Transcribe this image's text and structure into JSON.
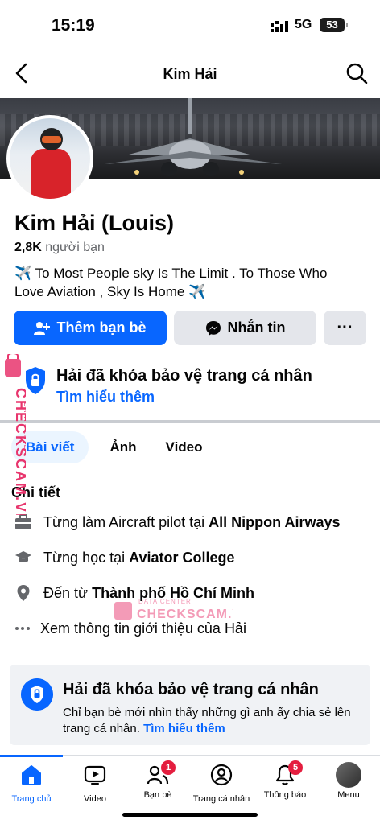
{
  "status_bar": {
    "time": "15:19",
    "network": "5G",
    "battery": "53"
  },
  "header": {
    "title": "Kim Hải"
  },
  "profile": {
    "name": "Kim Hải (Louis)",
    "friends_count": "2,8K",
    "friends_label": "người bạn",
    "bio_line1": "To Most People sky Is The Limit . To Those Who",
    "bio_line2": "Love Aviation , Sky Is Home"
  },
  "actions": {
    "add_friend": "Thêm bạn bè",
    "message": "Nhắn tin",
    "more": "···"
  },
  "lock_banner": {
    "title": "Hải đã khóa bảo vệ trang cá nhân",
    "link": "Tìm hiểu thêm"
  },
  "tabs": [
    "Bài viết",
    "Ảnh",
    "Video"
  ],
  "details": {
    "heading": "Chi tiết",
    "work_prefix": "Từng làm Aircraft pilot tại ",
    "work_place": "All Nippon Airways",
    "school_prefix": "Từng học tại ",
    "school_name": "Aviator College",
    "from_prefix": "Đến từ ",
    "from_place": "Thành phố Hồ Chí Minh",
    "about_link": "Xem thông tin giới thiệu của Hải"
  },
  "lock_card": {
    "title": "Hải đã khóa bảo vệ trang cá nhân",
    "desc": "Chỉ bạn bè mới nhìn thấy những gì anh ấy chia sẻ lên trang cá nhân.",
    "link": "Tìm hiểu thêm"
  },
  "bottom_nav": [
    {
      "label": "Trang chủ",
      "icon": "home-icon"
    },
    {
      "label": "Video",
      "icon": "video-icon"
    },
    {
      "label": "Bạn bè",
      "icon": "friends-icon",
      "badge": "1"
    },
    {
      "label": "Trang cá nhân",
      "icon": "profile-icon"
    },
    {
      "label": "Thông báo",
      "icon": "bell-icon",
      "badge": "5"
    },
    {
      "label": "Menu",
      "icon": "menu-avatar-icon"
    }
  ],
  "watermark": {
    "brand": "CHECKSCAM.VN",
    "sub": "DATA CENTER"
  },
  "colors": {
    "accent": "#0866ff",
    "badge": "#e41e3f",
    "button_gray": "#e4e6eb",
    "watermark": "#e8356d"
  }
}
